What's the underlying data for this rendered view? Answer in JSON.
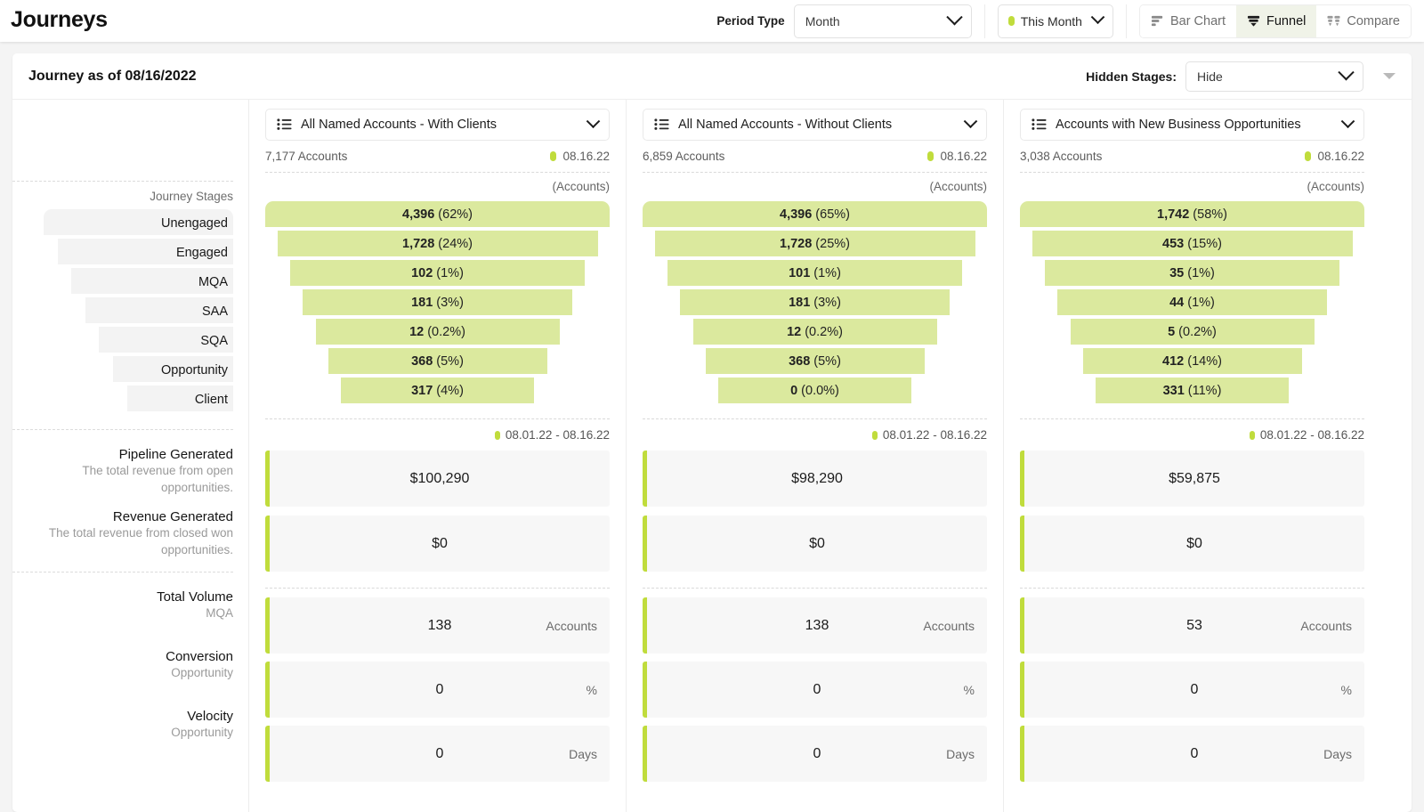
{
  "header": {
    "title": "Journeys",
    "period_type_label": "Period Type",
    "period_type_value": "Month",
    "date_range_chip": "This Month",
    "views": [
      {
        "label": "Bar Chart",
        "icon": "bar-chart-icon",
        "active": false
      },
      {
        "label": "Funnel",
        "icon": "funnel-icon",
        "active": true
      },
      {
        "label": "Compare",
        "icon": "compare-icon",
        "active": false
      }
    ]
  },
  "card": {
    "title": "Journey as of 08/16/2022",
    "hidden_stages_label": "Hidden Stages:",
    "hidden_stages_value": "Hide"
  },
  "sidebar": {
    "stages_title": "Journey Stages",
    "stages": [
      "Unengaged",
      "Engaged",
      "MQA",
      "SAA",
      "SQA",
      "Opportunity",
      "Client"
    ],
    "metrics": [
      {
        "name": "Pipeline Generated",
        "sub": "The total revenue from open opportunities."
      },
      {
        "name": "Revenue Generated",
        "sub": "The total revenue from closed won opportunities."
      },
      {
        "name": "Total Volume",
        "sub": "MQA"
      },
      {
        "name": "Conversion",
        "sub": "Opportunity"
      },
      {
        "name": "Velocity",
        "sub": "Opportunity"
      }
    ]
  },
  "unit_header": "(Accounts)",
  "columns": [
    {
      "selector": "All Named Accounts - With Clients",
      "accounts": "7,177 Accounts",
      "stamp": "08.16.22",
      "range_stamp": "08.01.22 - 08.16.22",
      "funnel": [
        {
          "value": "4,396",
          "pct": "(62%)"
        },
        {
          "value": "1,728",
          "pct": "(24%)"
        },
        {
          "value": "102",
          "pct": "(1%)"
        },
        {
          "value": "181",
          "pct": "(3%)"
        },
        {
          "value": "12",
          "pct": "(0.2%)"
        },
        {
          "value": "368",
          "pct": "(5%)"
        },
        {
          "value": "317",
          "pct": "(4%)"
        }
      ],
      "metrics": [
        {
          "value": "$100,290",
          "unit": ""
        },
        {
          "value": "$0",
          "unit": ""
        },
        {
          "value": "138",
          "unit": "Accounts"
        },
        {
          "value": "0",
          "unit": "%"
        },
        {
          "value": "0",
          "unit": "Days"
        }
      ]
    },
    {
      "selector": "All Named Accounts - Without Clients",
      "accounts": "6,859 Accounts",
      "stamp": "08.16.22",
      "range_stamp": "08.01.22 - 08.16.22",
      "funnel": [
        {
          "value": "4,396",
          "pct": "(65%)"
        },
        {
          "value": "1,728",
          "pct": "(25%)"
        },
        {
          "value": "101",
          "pct": "(1%)"
        },
        {
          "value": "181",
          "pct": "(3%)"
        },
        {
          "value": "12",
          "pct": "(0.2%)"
        },
        {
          "value": "368",
          "pct": "(5%)"
        },
        {
          "value": "0",
          "pct": "(0.0%)"
        }
      ],
      "metrics": [
        {
          "value": "$98,290",
          "unit": ""
        },
        {
          "value": "$0",
          "unit": ""
        },
        {
          "value": "138",
          "unit": "Accounts"
        },
        {
          "value": "0",
          "unit": "%"
        },
        {
          "value": "0",
          "unit": "Days"
        }
      ]
    },
    {
      "selector": "Accounts with New Business Opportunities",
      "accounts": "3,038 Accounts",
      "stamp": "08.16.22",
      "range_stamp": "08.01.22 - 08.16.22",
      "funnel": [
        {
          "value": "1,742",
          "pct": "(58%)"
        },
        {
          "value": "453",
          "pct": "(15%)"
        },
        {
          "value": "35",
          "pct": "(1%)"
        },
        {
          "value": "44",
          "pct": "(1%)"
        },
        {
          "value": "5",
          "pct": "(0.2%)"
        },
        {
          "value": "412",
          "pct": "(14%)"
        },
        {
          "value": "331",
          "pct": "(11%)"
        }
      ],
      "metrics": [
        {
          "value": "$59,875",
          "unit": ""
        },
        {
          "value": "$0",
          "unit": ""
        },
        {
          "value": "53",
          "unit": "Accounts"
        },
        {
          "value": "0",
          "unit": "%"
        },
        {
          "value": "0",
          "unit": "Days"
        }
      ]
    }
  ],
  "chart_data": {
    "type": "bar",
    "title": "Journey as of 08/16/2022",
    "xlabel": "",
    "ylabel": "Accounts",
    "categories": [
      "Unengaged",
      "Engaged",
      "MQA",
      "SAA",
      "SQA",
      "Opportunity",
      "Client"
    ],
    "series": [
      {
        "name": "All Named Accounts - With Clients",
        "values": [
          4396,
          1728,
          102,
          181,
          12,
          368,
          317
        ],
        "percents": [
          62,
          24,
          1,
          3,
          0.2,
          5,
          4
        ],
        "total": 7177
      },
      {
        "name": "All Named Accounts - Without Clients",
        "values": [
          4396,
          1728,
          101,
          181,
          12,
          368,
          0
        ],
        "percents": [
          65,
          25,
          1,
          3,
          0.2,
          5,
          0.0
        ],
        "total": 6859
      },
      {
        "name": "Accounts with New Business Opportunities",
        "values": [
          1742,
          453,
          35,
          44,
          5,
          412,
          331
        ],
        "percents": [
          58,
          15,
          1,
          1,
          0.2,
          14,
          11
        ],
        "total": 3038
      }
    ],
    "legend": "none",
    "grid": false
  },
  "colors": {
    "accent": "#c0dc3c",
    "funnel_bar": "#dbe99e",
    "stage_bg": "#f3f3f3",
    "metric_bg": "#f7f7f7",
    "page_bg": "#f4f4f4"
  }
}
